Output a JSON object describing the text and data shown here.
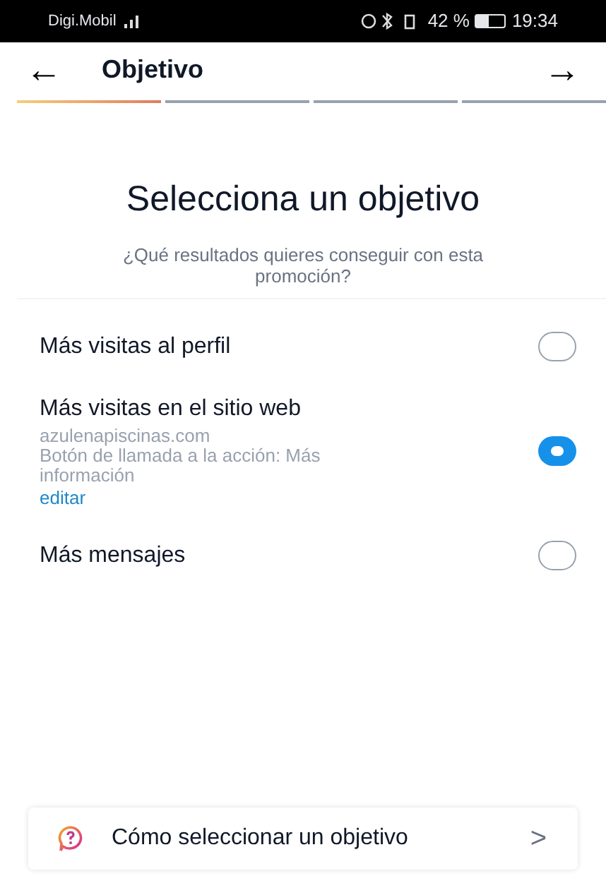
{
  "status_bar": {
    "carrier": "Digi.Mobil",
    "battery": "42 %",
    "time": "19:34"
  },
  "header": {
    "back": "←",
    "title": "Objetivo",
    "next": "→"
  },
  "steps": [
    {
      "selected": true
    },
    {
      "selected": false
    },
    {
      "selected": false
    },
    {
      "selected": false
    }
  ],
  "heading": "Selecciona un objetivo",
  "subtitle": "¿Qué resultados quieres conseguir con esta promoción?",
  "options": [
    {
      "label": "Más visitas al perfil",
      "selected": false
    },
    {
      "label": "Más visitas en el sitio web",
      "selected": true,
      "details": [
        "azulenapiscinas.com",
        "Botón de llamada a la acción: Más información"
      ],
      "link": "editar"
    },
    {
      "label": "Más mensajes",
      "selected": false
    }
  ],
  "help": {
    "label": "Cómo seleccionar un objetivo",
    "chevron": ">"
  }
}
